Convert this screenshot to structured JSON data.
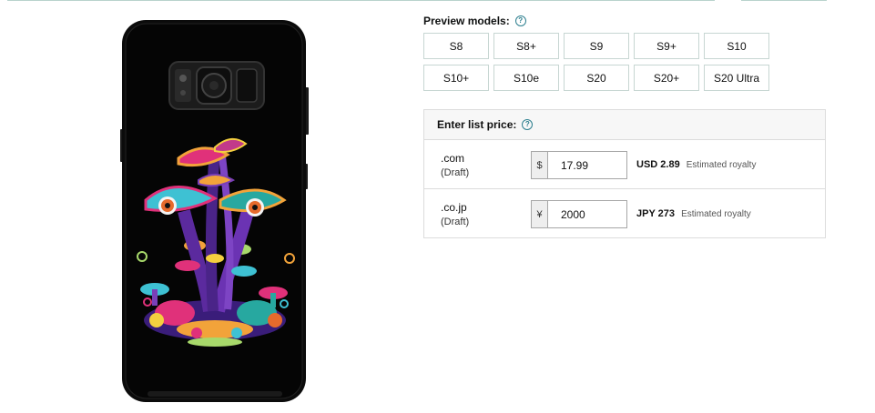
{
  "preview": {
    "title": "Preview models:",
    "models": [
      "S8",
      "S8+",
      "S9",
      "S9+",
      "S10",
      "S10+",
      "S10e",
      "S20",
      "S20+",
      "S20 Ultra"
    ]
  },
  "pricing": {
    "title": "Enter list price:",
    "rows": [
      {
        "domain": ".com",
        "status": "(Draft)",
        "currency_symbol": "$",
        "price": "17.99",
        "royalty_amount": "USD 2.89",
        "royalty_label": "Estimated royalty"
      },
      {
        "domain": ".co.jp",
        "status": "(Draft)",
        "currency_symbol": "¥",
        "price": "2000",
        "royalty_amount": "JPY 273",
        "royalty_label": "Estimated royalty"
      }
    ]
  },
  "icons": {
    "help": "question-circle-icon",
    "phone": "phone-case-preview"
  },
  "colors": {
    "accent": "#2d7f8f",
    "border": "#c7d6d2",
    "phone_body": "#0b0b0b"
  }
}
